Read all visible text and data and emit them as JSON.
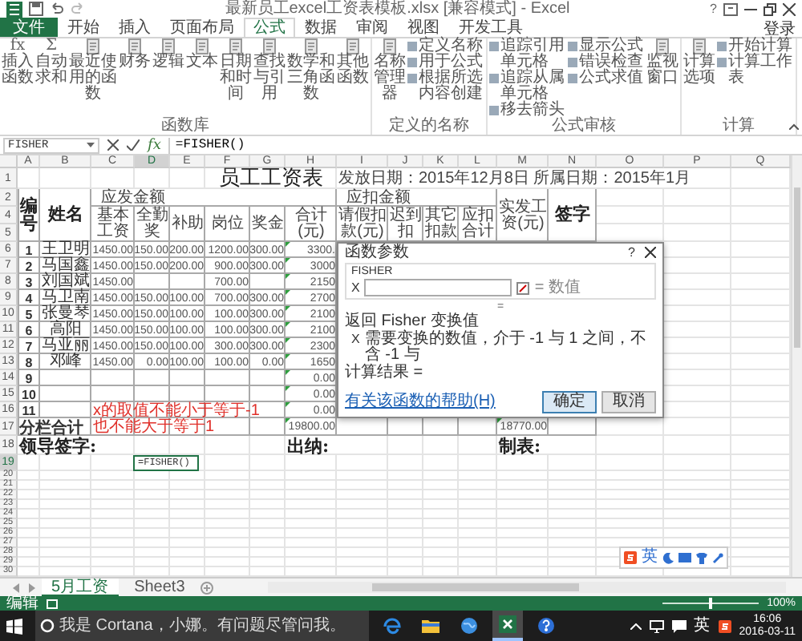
{
  "window": {
    "title": "最新员工excel工资表模板.xlsx [兼容模式] - Excel",
    "help": "?"
  },
  "tabs": [
    {
      "label": "文件",
      "selected": false,
      "kind": "file"
    },
    {
      "label": "开始",
      "selected": false,
      "kind": "tab"
    },
    {
      "label": "插入",
      "selected": false,
      "kind": "tab"
    },
    {
      "label": "页面布局",
      "selected": false,
      "kind": "tab"
    },
    {
      "label": "公式",
      "selected": true,
      "kind": "tab"
    },
    {
      "label": "数据",
      "selected": false,
      "kind": "tab"
    },
    {
      "label": "审阅",
      "selected": false,
      "kind": "tab"
    },
    {
      "label": "视图",
      "selected": false,
      "kind": "tab"
    },
    {
      "label": "开发工具",
      "selected": false,
      "kind": "tab"
    }
  ],
  "account": "登录",
  "ribbon": [
    {
      "label": "函数库",
      "items": [
        {
          "kind": "large",
          "label": "插入函数",
          "glyph": "fx"
        },
        {
          "kind": "large",
          "label": "自动求和",
          "glyph": "Σ"
        },
        {
          "kind": "wide",
          "label": "最近使用的函数"
        },
        {
          "kind": "large",
          "label": "财务"
        },
        {
          "kind": "large",
          "label": "逻辑"
        },
        {
          "kind": "large",
          "label": "文本"
        },
        {
          "kind": "large",
          "label": "日期和时间"
        },
        {
          "kind": "large",
          "label": "查找与引用"
        },
        {
          "kind": "wide",
          "label": "数学和三角函数"
        },
        {
          "kind": "large",
          "label": "其他函数"
        }
      ]
    },
    {
      "label": "定义的名称",
      "items": [
        {
          "kind": "large",
          "label": "名称管理器"
        },
        {
          "kind": "list",
          "entries": [
            "定义名称",
            "用于公式",
            "根据所选内容创建"
          ]
        }
      ]
    },
    {
      "label": "公式审核",
      "items": [
        {
          "kind": "list",
          "entries": [
            "追踪引用单元格",
            "追踪从属单元格",
            "移去箭头"
          ]
        },
        {
          "kind": "list",
          "entries": [
            "显示公式",
            "错误检查",
            "公式求值"
          ]
        },
        {
          "kind": "large",
          "label": "监视窗口"
        }
      ]
    },
    {
      "label": "计算",
      "items": [
        {
          "kind": "large",
          "label": "计算选项"
        },
        {
          "kind": "list",
          "entries": [
            "开始计算",
            "计算工作表"
          ]
        }
      ]
    }
  ],
  "formula_bar": {
    "name_box": "FISHER",
    "fx": "fx",
    "formula": "=FISHER()"
  },
  "sheet": {
    "columns": [
      "A",
      "B",
      "C",
      "D",
      "E",
      "F",
      "G",
      "H",
      "I",
      "J",
      "K",
      "L",
      "M",
      "N",
      "O",
      "P",
      "Q"
    ],
    "rows": [
      {
        "num": "1",
        "kind": "title",
        "cells": [
          "",
          "",
          "",
          "",
          "",
          "员工工资表",
          "",
          "",
          "发放日期：2015年12月8日 所属日期：2015年1月"
        ]
      },
      {
        "num": "2",
        "kind": "header",
        "cells": [
          "编号",
          "姓名",
          "应发金额",
          "",
          "",
          "",
          "",
          "",
          "应扣金额",
          "",
          "",
          "",
          "实发工资(元)",
          "签字"
        ]
      },
      {
        "num": "4",
        "kind": "header",
        "cells": [
          "",
          "",
          "基本工资",
          "全勤奖",
          "补助",
          "岗位",
          "奖金",
          "合计(元)",
          "请假扣款(元)",
          "迟到扣",
          "其它扣款",
          "应扣合计"
        ]
      },
      {
        "num": "5",
        "kind": "header",
        "cells": []
      },
      {
        "num": "6",
        "kind": "data",
        "flagged": true,
        "cells": [
          "1",
          "王卫明",
          "1450.00",
          "150.00",
          "200.00",
          "1200.00",
          "300.00",
          "3300."
        ]
      },
      {
        "num": "7",
        "kind": "data",
        "flagged": true,
        "cells": [
          "2",
          "马国鑫",
          "1450.00",
          "150.00",
          "200.00",
          "900.00",
          "300.00",
          "3000"
        ]
      },
      {
        "num": "8",
        "kind": "data",
        "flagged": true,
        "cells": [
          "3",
          "刘国斌",
          "1450.00",
          "",
          "",
          "700.00",
          "",
          "2150"
        ]
      },
      {
        "num": "9",
        "kind": "data",
        "flagged": true,
        "cells": [
          "4",
          "马卫南",
          "1450.00",
          "150.00",
          "100.00",
          "700.00",
          "300.00",
          "2700"
        ]
      },
      {
        "num": "10",
        "kind": "data",
        "flagged": true,
        "cells": [
          "5",
          "张曼琴",
          "1450.00",
          "150.00",
          "100.00",
          "100.00",
          "300.00",
          "2100"
        ]
      },
      {
        "num": "11",
        "kind": "data",
        "flagged": true,
        "cells": [
          "6",
          "高阳",
          "1450.00",
          "150.00",
          "100.00",
          "100.00",
          "300.00",
          "2100"
        ]
      },
      {
        "num": "12",
        "kind": "data",
        "flagged": true,
        "cells": [
          "7",
          "马亚丽",
          "1450.00",
          "150.00",
          "100.00",
          "300.00",
          "300.00",
          "2300"
        ]
      },
      {
        "num": "13",
        "kind": "data",
        "flagged": true,
        "cells": [
          "8",
          "邓峰",
          "1450.00",
          "0.00",
          "100.00",
          "100.00",
          "0.00",
          "1650"
        ]
      },
      {
        "num": "14",
        "kind": "data",
        "flagged": true,
        "cells": [
          "9",
          "",
          "",
          "",
          "",
          "",
          "",
          "0.00"
        ]
      },
      {
        "num": "15",
        "kind": "data",
        "flagged": true,
        "cells": [
          "10",
          "",
          "",
          "",
          "",
          "",
          "",
          "0.00"
        ]
      },
      {
        "num": "16",
        "kind": "data",
        "flagged": true,
        "cells": [
          "11",
          "",
          "",
          "",
          "",
          "",
          "",
          "0.00"
        ]
      },
      {
        "num": "17",
        "kind": "total",
        "flagged": true,
        "cells": [
          "分栏合计",
          "",
          "",
          "",
          "",
          "",
          "",
          "19800.00",
          "",
          "",
          "",
          "",
          "18770.00"
        ]
      },
      {
        "num": "18",
        "kind": "sign",
        "cells": [
          "领导签字:",
          "",
          "",
          "",
          "",
          "",
          "",
          "出纳:",
          "",
          "",
          "",
          "",
          "制表:"
        ]
      },
      {
        "num": "19",
        "kind": "edit",
        "cells": [
          "",
          "",
          "",
          "=FISHER()"
        ]
      },
      {
        "num": "20",
        "kind": "blank",
        "cells": []
      },
      {
        "num": "21",
        "kind": "blank",
        "cells": []
      },
      {
        "num": "22",
        "kind": "blank",
        "cells": []
      },
      {
        "num": "23",
        "kind": "blank",
        "cells": []
      },
      {
        "num": "24",
        "kind": "blank",
        "cells": []
      },
      {
        "num": "25",
        "kind": "blank",
        "cells": []
      },
      {
        "num": "26",
        "kind": "blank",
        "cells": []
      },
      {
        "num": "27",
        "kind": "blank",
        "cells": []
      },
      {
        "num": "28",
        "kind": "blank",
        "cells": []
      },
      {
        "num": "29",
        "kind": "blank",
        "cells": []
      },
      {
        "num": "30",
        "kind": "blank",
        "cells": []
      }
    ]
  },
  "note": [
    "x的取值不能小于等于-1",
    "也不能大于等于1"
  ],
  "dialog": {
    "title": "函数参数",
    "help": "?",
    "function": "FISHER",
    "args": [
      {
        "name": "X",
        "result": "= 数值"
      }
    ],
    "equals": "=",
    "description": "返回 Fisher 变换值",
    "arg_help": {
      "name": "X",
      "text": "需要变换的数值，介于 -1 与 1 之间，不含 -1 与"
    },
    "result_label": "计算结果 =",
    "help_link": "有关该函数的帮助(H)",
    "buttons": [
      {
        "label": "确定",
        "default": true
      },
      {
        "label": "取消",
        "default": false
      }
    ]
  },
  "ime": {
    "mode": "英"
  },
  "sheet_tabs": [
    {
      "label": "5月工资",
      "selected": true
    },
    {
      "label": "Sheet3",
      "selected": false
    }
  ],
  "status": {
    "mode": "编辑",
    "zoom": "100%",
    "zoom_slider": {
      "level": 0.5
    }
  },
  "taskbar": {
    "placeholder": "我是 Cortana，小娜。有问题尽管问我。",
    "apps": [
      {
        "kind": "browser",
        "active": false
      },
      {
        "kind": "folder",
        "active": false
      },
      {
        "kind": "globe",
        "active": false
      },
      {
        "kind": "spreadsheet",
        "active": true
      },
      {
        "kind": "help",
        "active": false
      }
    ],
    "input_mode": "英",
    "time": "16:06",
    "date": "2016-03-11"
  }
}
